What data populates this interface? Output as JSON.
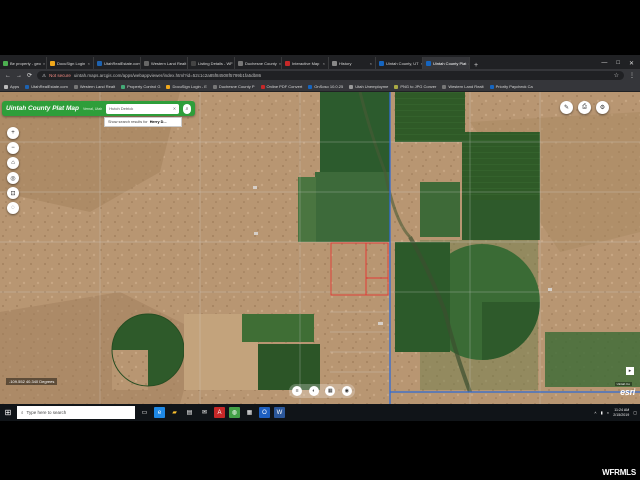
{
  "browser": {
    "tabs": [
      {
        "label": "Be property - geo",
        "color": "#4caf50"
      },
      {
        "label": "DocuSign Login",
        "color": "#f0a81c"
      },
      {
        "label": "UtahRealEstate.com",
        "color": "#1d62b0"
      },
      {
        "label": "Western Land Realt",
        "color": "#666"
      },
      {
        "label": "Listing Details - WF",
        "color": "#444"
      },
      {
        "label": "Duchesne County",
        "color": "#777"
      },
      {
        "label": "Interactive Map",
        "color": "#c62828"
      },
      {
        "label": "History",
        "color": "#888"
      },
      {
        "label": "Uintah County, UT",
        "color": "#1565c0"
      },
      {
        "label": "Uintah County Plat",
        "color": "#1565c0",
        "active": true
      }
    ],
    "new_tab": "+",
    "window_controls": [
      "—",
      "□",
      "✕"
    ],
    "not_secure": "Not secure",
    "url": "uintah.maps.arcgis.com/apps/webappviewer/index.html?id=52c1c2a85f84508f5799b1fa5db86",
    "bookmarks": [
      {
        "label": "Apps",
        "color": "#bbb"
      },
      {
        "label": "UtahRealEstate.com",
        "color": "#1d62b0"
      },
      {
        "label": "Western Land Realt",
        "color": "#777"
      },
      {
        "label": "Property Control G",
        "color": "#4a7"
      },
      {
        "label": "DocuSign Login - E",
        "color": "#f0a81c"
      },
      {
        "label": "Duchesne County P",
        "color": "#777"
      },
      {
        "label": "Online PDF Convert",
        "color": "#c62828"
      },
      {
        "label": "OnSoso 10.0.25",
        "color": "#1565c0"
      },
      {
        "label": "Utah Unemployme",
        "color": "#999"
      },
      {
        "label": "PNG to JPG Conver",
        "color": "#aa4"
      },
      {
        "label": "Western Land Realt",
        "color": "#777"
      },
      {
        "label": "Priority Paycheck Ca",
        "color": "#1565c0"
      }
    ]
  },
  "app": {
    "title": "Uintah County Plat Map",
    "tagline": "Vernal, Utah",
    "search_value": "Hutch Detrick",
    "suggestion_prefix": "Show search results for",
    "suggestion_term": "Herry D...",
    "zoom_in": "+",
    "zoom_out": "−",
    "coords": "-109.552 40.340 Degrees",
    "attribution": "Uintah Co",
    "esri": "esri"
  },
  "taskbar": {
    "search_placeholder": "Type here to search",
    "time": "11:24 AM",
    "date": "2/15/2019"
  },
  "watermark": "WFRMLS",
  "colors": {
    "header_green": "#2e9e3a",
    "parcel_red": "#e53935",
    "road_blue": "#2f6bd6"
  }
}
